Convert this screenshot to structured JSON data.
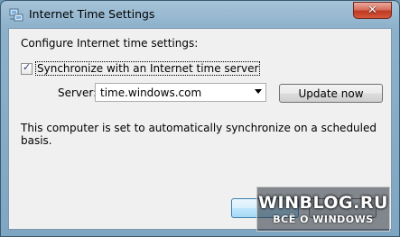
{
  "window": {
    "title": "Internet Time Settings",
    "close_glyph": "✕"
  },
  "dialog": {
    "heading": "Configure Internet time settings:",
    "sync_checkbox": {
      "label": "Synchronize with an Internet time server",
      "checked": true,
      "check_glyph": "✓"
    },
    "server": {
      "label": "Server:",
      "value": "time.windows.com"
    },
    "update_button": "Update now",
    "status": "This computer is set to automatically synchronize on a scheduled basis."
  },
  "watermark": {
    "main": "WINBLOG.RU",
    "sub": "ВСЁ О WINDOWS"
  },
  "colors": {
    "close_button": "#c03a22",
    "title_bar": "#8db1cb",
    "client_bg": "#f0f0f0",
    "ok_button_accent": "#3c7fb1"
  },
  "icons": {
    "app": "clock-network-icon",
    "close": "close-icon",
    "combo": "chevron-down-icon"
  }
}
